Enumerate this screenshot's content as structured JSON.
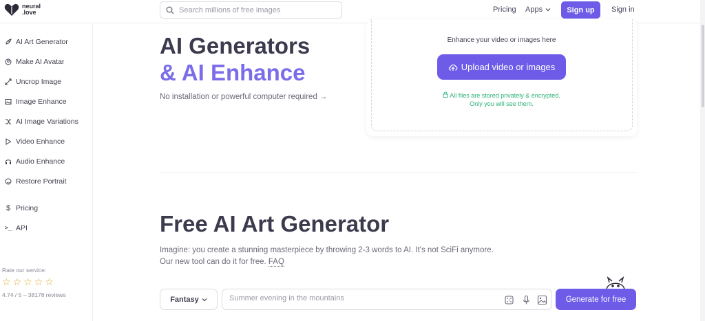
{
  "header": {
    "logo_line1": "neural",
    "logo_line2": ".love",
    "search_placeholder": "Search millions of free images",
    "pricing": "Pricing",
    "apps": "Apps",
    "signup": "Sign up",
    "signin": "Sign in"
  },
  "sidebar": {
    "items": [
      {
        "label": "AI Art Generator",
        "icon": "rocket-icon"
      },
      {
        "label": "Make AI Avatar",
        "icon": "avatar-icon"
      },
      {
        "label": "Uncrop Image",
        "icon": "expand-icon"
      },
      {
        "label": "Image Enhance",
        "icon": "image-icon"
      },
      {
        "label": "AI Image Variations",
        "icon": "shuffle-icon"
      },
      {
        "label": "Video Enhance",
        "icon": "play-icon"
      },
      {
        "label": "Audio Enhance",
        "icon": "headphones-icon"
      },
      {
        "label": "Restore Portrait",
        "icon": "smile-icon"
      },
      {
        "label": "Pricing",
        "icon": "dollar-icon"
      },
      {
        "label": "API",
        "icon": "terminal-icon"
      }
    ],
    "rate_label": "Rate our service:",
    "rating_stars": 5,
    "rate_value": "4.74 / 5 – 38178 reviews"
  },
  "hero": {
    "title_line1": "AI Generators",
    "title_line2": "& AI Enhance",
    "subtitle": "No installation or powerful computer required →"
  },
  "upload": {
    "label": "Enhance your video or images here",
    "button": "Upload video or images",
    "secure_line1": "All files are stored privately & encrypted.",
    "secure_line2": "Only you will see them."
  },
  "generator": {
    "title": "Free AI Art Generator",
    "desc_line1": "Imagine: you create a stunning masterpiece by throwing 2-3 words to AI. It's not SciFi anymore.",
    "desc_line2_prefix": "Our new tool can do it for free.",
    "faq": "FAQ",
    "style": "Fantasy",
    "prompt_placeholder": "Summer evening in the mountains",
    "generate_button": "Generate for free"
  },
  "colors": {
    "accent": "#6e5ce8",
    "accent_light": "#7b6ce9",
    "secure_green": "#2eb27a",
    "star": "#d9a520"
  }
}
